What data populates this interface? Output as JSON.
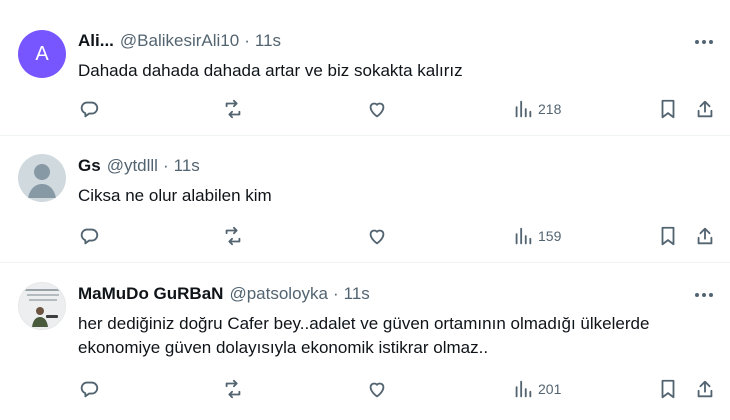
{
  "tweets": [
    {
      "avatar_letter": "A",
      "name": "Ali...",
      "handle": "@BalikesirAli10",
      "time": "11s",
      "text_lines": [
        "Dahada dahada dahada artar ve biz sokakta kalırız"
      ],
      "views": "218"
    },
    {
      "name": "Gs",
      "handle": "@ytdlll",
      "time": "11s",
      "text_lines": [
        "Ciksa ne olur alabilen kim"
      ],
      "views": "159"
    },
    {
      "name": "MaMuDo GuRBaN",
      "handle": "@patsoloyka",
      "time": "11s",
      "text_lines": [
        "her dediğiniz doğru Cafer bey..adalet ve güven ortamının olmadığı ülkelerde",
        "ekonomiye güven dolayısıyla ekonomik istikrar olmaz.."
      ],
      "views": "201"
    }
  ],
  "separator": "·",
  "icons": {
    "more": "more-horizontal-icon",
    "reply": "reply-icon",
    "retweet": "retweet-icon",
    "like": "heart-icon",
    "views": "views-chart-icon",
    "bookmark": "bookmark-icon",
    "share": "share-icon"
  },
  "colors": {
    "text": "#0f1419",
    "secondary": "#536471",
    "avatar_accent": "#7856ff",
    "divider": "#eff3f4"
  }
}
